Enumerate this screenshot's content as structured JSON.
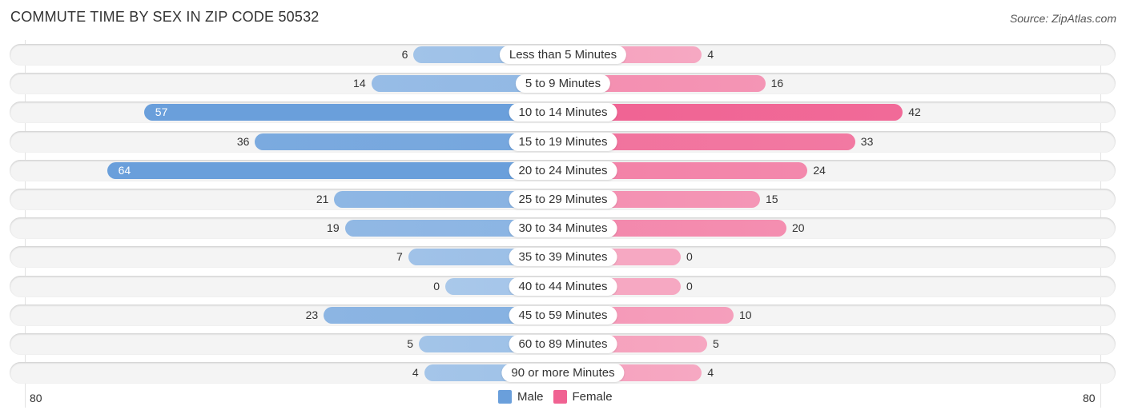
{
  "header": {
    "title": "COMMUTE TIME BY SEX IN ZIP CODE 50532",
    "source": "Source: ZipAtlas.com"
  },
  "colors": {
    "male_strong": "#6a9fdb",
    "male_light": "#a9c8ea",
    "female_strong": "#f06292",
    "female_light": "#f6a8c2"
  },
  "chart_data": {
    "type": "bar",
    "orientation": "horizontal-diverging",
    "title": "COMMUTE TIME BY SEX IN ZIP CODE 50532",
    "categories": [
      "Less than 5 Minutes",
      "5 to 9 Minutes",
      "10 to 14 Minutes",
      "15 to 19 Minutes",
      "20 to 24 Minutes",
      "25 to 29 Minutes",
      "30 to 34 Minutes",
      "35 to 39 Minutes",
      "40 to 44 Minutes",
      "45 to 59 Minutes",
      "60 to 89 Minutes",
      "90 or more Minutes"
    ],
    "series": [
      {
        "name": "Male",
        "side": "left",
        "values": [
          6,
          14,
          57,
          36,
          64,
          21,
          19,
          7,
          0,
          23,
          5,
          4
        ]
      },
      {
        "name": "Female",
        "side": "right",
        "values": [
          4,
          16,
          42,
          33,
          24,
          15,
          20,
          0,
          0,
          10,
          5,
          4
        ]
      }
    ],
    "axis": {
      "left_max_label": "80",
      "right_max_label": "80",
      "range": [
        0,
        80
      ]
    },
    "legend": {
      "position": "bottom-center",
      "entries": [
        "Male",
        "Female"
      ]
    },
    "grid": false
  }
}
